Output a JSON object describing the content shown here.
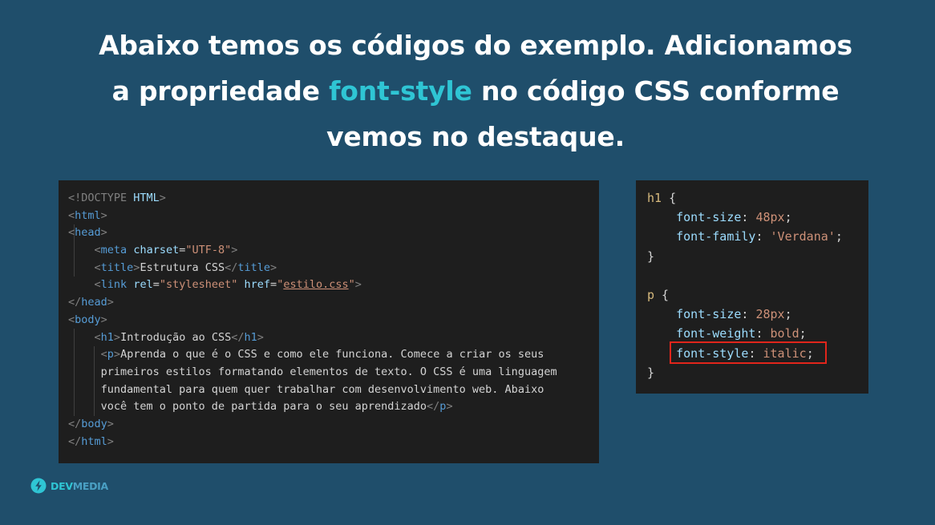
{
  "headline": {
    "line1": "Abaixo temos os códigos do exemplo. Adicionamos",
    "line2_before": "a propriedade ",
    "line2_highlight": "font-style",
    "line2_after": " no código CSS conforme",
    "line3": "vemos no destaque."
  },
  "html_code": {
    "doctype_open": "<!DOCTYPE",
    "doctype_name": " HTML",
    "doctype_close": ">",
    "tag_html": "html",
    "tag_head": "head",
    "tag_meta": "meta",
    "attr_charset": "charset",
    "val_charset": "\"UTF-8\"",
    "tag_title": "title",
    "title_text": "Estrutura CSS",
    "tag_link": "link",
    "attr_rel": "rel",
    "val_rel": "\"stylesheet\"",
    "attr_href": "href",
    "val_href_q": "\"",
    "val_href": "estilo.css",
    "tag_body": "body",
    "tag_h1": "h1",
    "h1_text": "Introdução ao CSS",
    "tag_p": "p",
    "p_line1": "Aprenda o que é o CSS e como ele funciona. Comece a criar os seus",
    "p_line2": "primeiros estilos formatando elementos de texto. O CSS é uma linguagem",
    "p_line3": "fundamental para quem quer trabalhar com desenvolvimento web. Abaixo",
    "p_line4": "você tem o ponto de partida para o seu aprendizado"
  },
  "css_code": {
    "sel_h1": "h1",
    "sel_p": "p",
    "brace_open": " {",
    "brace_close": "}",
    "prop_font_size": "font-size",
    "prop_font_family": "font-family",
    "prop_font_weight": "font-weight",
    "prop_font_style": "font-style",
    "val_48": "48px",
    "val_verdana": "'Verdana'",
    "val_28": "28px",
    "val_bold": "bold",
    "val_italic": "italic"
  },
  "brand": {
    "dev": "DEV",
    "media": "MEDIA",
    "icon": "devmedia-logo-icon"
  },
  "colors": {
    "background": "#1f4e6b",
    "accent": "#2fc5d4",
    "highlight_border": "#e1251b",
    "code_background": "#1e1e1e"
  }
}
